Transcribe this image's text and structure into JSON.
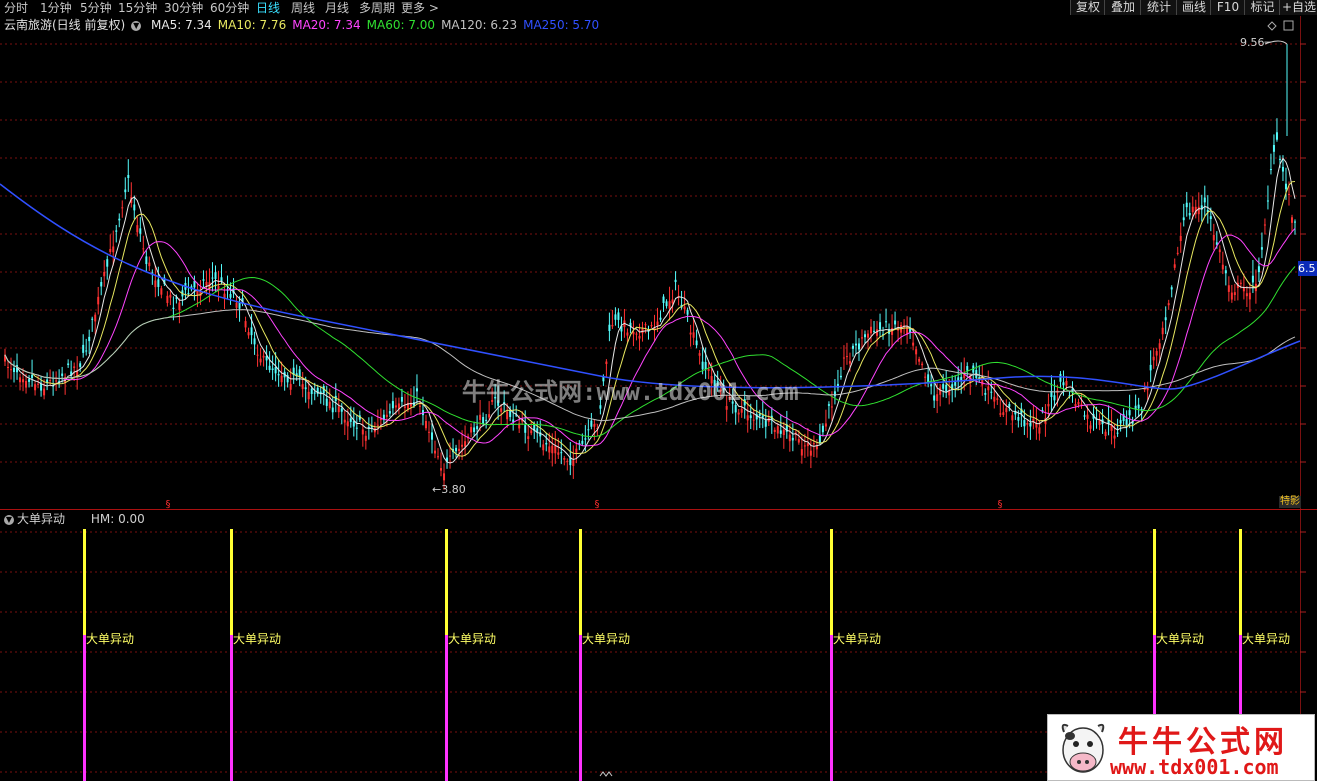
{
  "toolbar": {
    "periods": [
      {
        "label": "分时"
      },
      {
        "label": "1分钟"
      },
      {
        "label": "5分钟"
      },
      {
        "label": "15分钟"
      },
      {
        "label": "30分钟"
      },
      {
        "label": "60分钟"
      },
      {
        "label": "日线",
        "active": true
      },
      {
        "label": "周线"
      },
      {
        "label": "月线"
      },
      {
        "label": "多周期"
      },
      {
        "label": "更多 >"
      }
    ],
    "right_buttons": [
      "复权",
      "叠加",
      "统计",
      "画线",
      "F10",
      "标记",
      "+自选"
    ]
  },
  "legend": {
    "title": "云南旅游(日线 前复权)",
    "ma": [
      {
        "label": "MA5: 7.34",
        "color": "#e8e8e8"
      },
      {
        "label": "MA10: 7.76",
        "color": "#e8e860"
      },
      {
        "label": "MA20: 7.34",
        "color": "#ff44ff"
      },
      {
        "label": "MA60: 7.00",
        "color": "#30e030"
      },
      {
        "label": "MA120: 6.23",
        "color": "#c0c0c0"
      },
      {
        "label": "MA250: 5.70",
        "color": "#3050ff"
      }
    ]
  },
  "price": {
    "high_label": "9.56",
    "low_label": "3.80",
    "current_tag": "6.5"
  },
  "watermark": "牛牛公式网:www.tdx001.com",
  "indicator": {
    "name": "大单异动",
    "hm_label": "HM: 0.00",
    "signal_label": "大单异动",
    "signals": [
      0.0615,
      0.1754,
      0.3417,
      0.4454,
      0.6405,
      0.8906,
      0.9575
    ]
  },
  "logo": {
    "title": "牛牛公式网",
    "url": "www.tdx001.com"
  },
  "corner_tag": "特影",
  "colors": {
    "up": "#ff3232",
    "down": "#54fcfc",
    "grid": "#7a1010",
    "signal_top": "#ffff33",
    "signal_bottom": "#ff33ff"
  }
}
